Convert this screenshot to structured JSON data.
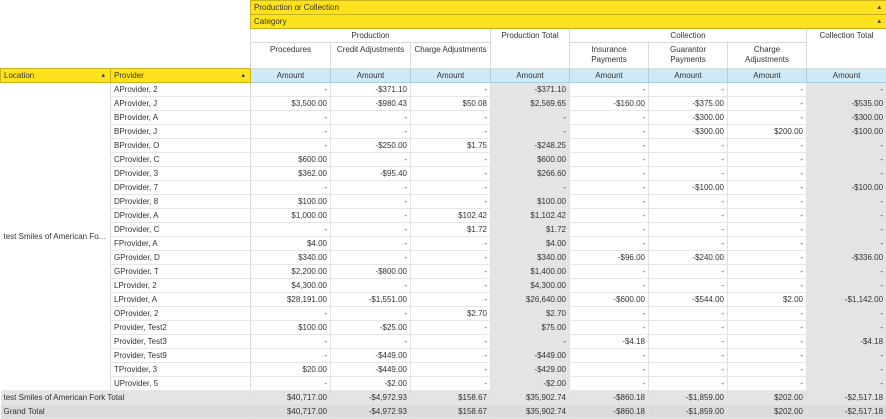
{
  "filters": {
    "production_or_collection": "Production or Collection",
    "category": "Category"
  },
  "headers": {
    "production": "Production",
    "production_total": "Production Total",
    "collection": "Collection",
    "collection_total": "Collection Total",
    "procedures": "Procedures",
    "credit_adjustments": "Credit Adjustments",
    "charge_adjustments_p": "Charge Adjustments",
    "insurance_payments": "Insurance Payments",
    "guarantor_payments": "Guarantor Payments",
    "charge_adjustments_c": "Charge Adjustments",
    "location": "Location",
    "provider": "Provider",
    "amount": "Amount"
  },
  "location_name": "test Smiles of American Fo...",
  "rows": [
    {
      "provider": "AProvider, 2",
      "procedures": "-",
      "credit_adj": "-$371.10",
      "charge_adj_p": "-",
      "prod_total": "-$371.10",
      "insurance": "-",
      "guarantor": "-",
      "charge_adj_c": "-",
      "coll_total": "-"
    },
    {
      "provider": "AProvider, J",
      "procedures": "$3,500.00",
      "credit_adj": "-$980.43",
      "charge_adj_p": "$50.08",
      "prod_total": "$2,569.65",
      "insurance": "-$160.00",
      "guarantor": "-$375.00",
      "charge_adj_c": "-",
      "coll_total": "-$535.00"
    },
    {
      "provider": "BProvider, A",
      "procedures": "-",
      "credit_adj": "-",
      "charge_adj_p": "-",
      "prod_total": "-",
      "insurance": "-",
      "guarantor": "-$300.00",
      "charge_adj_c": "-",
      "coll_total": "-$300.00"
    },
    {
      "provider": "BProvider, J",
      "procedures": "-",
      "credit_adj": "-",
      "charge_adj_p": "-",
      "prod_total": "-",
      "insurance": "-",
      "guarantor": "-$300.00",
      "charge_adj_c": "$200.00",
      "coll_total": "-$100.00"
    },
    {
      "provider": "BProvider, O",
      "procedures": "-",
      "credit_adj": "-$250.00",
      "charge_adj_p": "$1.75",
      "prod_total": "-$248.25",
      "insurance": "-",
      "guarantor": "-",
      "charge_adj_c": "-",
      "coll_total": "-"
    },
    {
      "provider": "CProvider, C",
      "procedures": "$600.00",
      "credit_adj": "-",
      "charge_adj_p": "-",
      "prod_total": "$600.00",
      "insurance": "-",
      "guarantor": "-",
      "charge_adj_c": "-",
      "coll_total": "-"
    },
    {
      "provider": "DProvider, 3",
      "procedures": "$362.00",
      "credit_adj": "-$95.40",
      "charge_adj_p": "-",
      "prod_total": "$266.60",
      "insurance": "-",
      "guarantor": "-",
      "charge_adj_c": "-",
      "coll_total": "-"
    },
    {
      "provider": "DProvider, 7",
      "procedures": "-",
      "credit_adj": "-",
      "charge_adj_p": "-",
      "prod_total": "-",
      "insurance": "-",
      "guarantor": "-$100.00",
      "charge_adj_c": "-",
      "coll_total": "-$100.00"
    },
    {
      "provider": "DProvider, 8",
      "procedures": "$100.00",
      "credit_adj": "-",
      "charge_adj_p": "-",
      "prod_total": "$100.00",
      "insurance": "-",
      "guarantor": "-",
      "charge_adj_c": "-",
      "coll_total": "-"
    },
    {
      "provider": "DProvider, A",
      "procedures": "$1,000.00",
      "credit_adj": "-",
      "charge_adj_p": "$102.42",
      "prod_total": "$1,102.42",
      "insurance": "-",
      "guarantor": "-",
      "charge_adj_c": "-",
      "coll_total": "-"
    },
    {
      "provider": "DProvider, C",
      "procedures": "-",
      "credit_adj": "-",
      "charge_adj_p": "$1.72",
      "prod_total": "$1.72",
      "insurance": "-",
      "guarantor": "-",
      "charge_adj_c": "-",
      "coll_total": "-"
    },
    {
      "provider": "FProvider, A",
      "procedures": "$4.00",
      "credit_adj": "-",
      "charge_adj_p": "-",
      "prod_total": "$4.00",
      "insurance": "-",
      "guarantor": "-",
      "charge_adj_c": "-",
      "coll_total": "-"
    },
    {
      "provider": "GProvider, D",
      "procedures": "$340.00",
      "credit_adj": "-",
      "charge_adj_p": "-",
      "prod_total": "$340.00",
      "insurance": "-$96.00",
      "guarantor": "-$240.00",
      "charge_adj_c": "-",
      "coll_total": "-$336.00"
    },
    {
      "provider": "GProvider, T",
      "procedures": "$2,200.00",
      "credit_adj": "-$800.00",
      "charge_adj_p": "-",
      "prod_total": "$1,400.00",
      "insurance": "-",
      "guarantor": "-",
      "charge_adj_c": "-",
      "coll_total": "-"
    },
    {
      "provider": "LProvider, 2",
      "procedures": "$4,300.00",
      "credit_adj": "-",
      "charge_adj_p": "-",
      "prod_total": "$4,300.00",
      "insurance": "-",
      "guarantor": "-",
      "charge_adj_c": "-",
      "coll_total": "-"
    },
    {
      "provider": "LProvider, A",
      "procedures": "$28,191.00",
      "credit_adj": "-$1,551.00",
      "charge_adj_p": "-",
      "prod_total": "$26,640.00",
      "insurance": "-$600.00",
      "guarantor": "-$544.00",
      "charge_adj_c": "$2.00",
      "coll_total": "-$1,142.00"
    },
    {
      "provider": "OProvider, 2",
      "procedures": "-",
      "credit_adj": "-",
      "charge_adj_p": "$2.70",
      "prod_total": "$2.70",
      "insurance": "-",
      "guarantor": "-",
      "charge_adj_c": "-",
      "coll_total": "-"
    },
    {
      "provider": "Provider, Test2",
      "procedures": "$100.00",
      "credit_adj": "-$25.00",
      "charge_adj_p": "-",
      "prod_total": "$75.00",
      "insurance": "-",
      "guarantor": "-",
      "charge_adj_c": "-",
      "coll_total": "-"
    },
    {
      "provider": "Provider, Test3",
      "procedures": "-",
      "credit_adj": "-",
      "charge_adj_p": "-",
      "prod_total": "-",
      "insurance": "-$4.18",
      "guarantor": "-",
      "charge_adj_c": "-",
      "coll_total": "-$4.18"
    },
    {
      "provider": "Provider, Test9",
      "procedures": "-",
      "credit_adj": "-$449.00",
      "charge_adj_p": "-",
      "prod_total": "-$449.00",
      "insurance": "-",
      "guarantor": "-",
      "charge_adj_c": "-",
      "coll_total": "-"
    },
    {
      "provider": "TProvider, 3",
      "procedures": "$20.00",
      "credit_adj": "-$449.00",
      "charge_adj_p": "-",
      "prod_total": "-$429.00",
      "insurance": "-",
      "guarantor": "-",
      "charge_adj_c": "-",
      "coll_total": "-"
    },
    {
      "provider": "UProvider, 5",
      "procedures": "-",
      "credit_adj": "-$2.00",
      "charge_adj_p": "-",
      "prod_total": "-$2.00",
      "insurance": "-",
      "guarantor": "-",
      "charge_adj_c": "-",
      "coll_total": "-"
    }
  ],
  "location_total": {
    "label": "test Smiles of American Fork Total",
    "procedures": "$40,717.00",
    "credit_adj": "-$4,972.93",
    "charge_adj_p": "$158.67",
    "prod_total": "$35,902.74",
    "insurance": "-$860.18",
    "guarantor": "-$1,859.00",
    "charge_adj_c": "$202.00",
    "coll_total": "-$2,517.18"
  },
  "grand_total": {
    "label": "Grand Total",
    "procedures": "$40,717.00",
    "credit_adj": "-$4,972.93",
    "charge_adj_p": "$158.67",
    "prod_total": "$35,902.74",
    "insurance": "-$860.18",
    "guarantor": "-$1,859.00",
    "charge_adj_c": "$202.00",
    "coll_total": "-$2,517.18"
  }
}
